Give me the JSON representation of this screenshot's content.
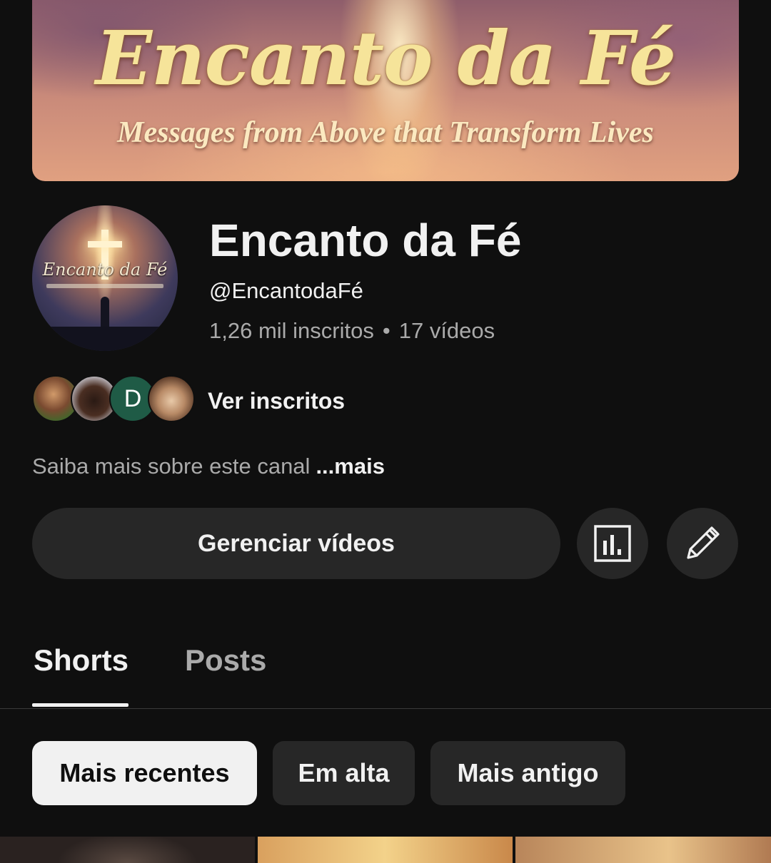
{
  "banner": {
    "title": "Encanto da Fé",
    "subtitle": "Messages from Above that Transform Lives"
  },
  "avatar": {
    "logo_text": "Encanto da Fé"
  },
  "channel": {
    "name": "Encanto da Fé",
    "handle": "@EncantodaFé",
    "subscribers": "1,26 mil inscritos",
    "separator": "•",
    "videos": "17 vídeos"
  },
  "subscribers_preview": {
    "avatar_letter": "D",
    "label": "Ver inscritos"
  },
  "about": {
    "text": "Saiba mais sobre este canal",
    "more": "...mais"
  },
  "actions": {
    "manage_label": "Gerenciar vídeos",
    "analytics_icon": "analytics-icon",
    "edit_icon": "pencil-icon"
  },
  "tabs": [
    {
      "label": "Shorts",
      "selected": true
    },
    {
      "label": "Posts",
      "selected": false
    }
  ],
  "filters": [
    {
      "label": "Mais recentes",
      "selected": true
    },
    {
      "label": "Em alta",
      "selected": false
    },
    {
      "label": "Mais antigo",
      "selected": false
    }
  ],
  "colors": {
    "background": "#0f0f0f",
    "surface": "#272727",
    "text_primary": "#f1f1f1",
    "text_secondary": "#aaaaaa",
    "chip_active_bg": "#f1f1f1"
  }
}
